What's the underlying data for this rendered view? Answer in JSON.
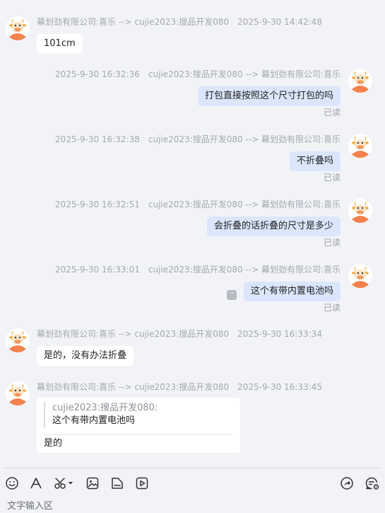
{
  "messages": [
    {
      "meta_name": "幕划劲有限公司:喜乐 --> cujie2023:搜品开发080",
      "time": "2025-9-30 14:42:48",
      "text": "101cm"
    },
    {
      "meta_name": "cujie2023:搜品开发080 --> 幕划劲有限公司:喜乐",
      "time": "2025-9-30 16:32:36",
      "text": "打包直接按照这个尺寸打包的吗",
      "status": "已读"
    },
    {
      "meta_name": "cujie2023:搜品开发080 --> 幕划劲有限公司:喜乐",
      "time": "2025-9-30 16:32:38",
      "text": "不折叠吗",
      "status": "已读"
    },
    {
      "meta_name": "cujie2023:搜品开发080 --> 幕划劲有限公司:喜乐",
      "time": "2025-9-30 16:32:51",
      "text": "会折叠的话折叠的尺寸是多少",
      "status": "已读"
    },
    {
      "meta_name": "cujie2023:搜品开发080 --> 幕划劲有限公司:喜乐",
      "time": "2025-9-30 16:33:01",
      "text": "这个有带内置电池吗",
      "status": "已读",
      "more_glyph": "···"
    },
    {
      "meta_name": "幕划劲有限公司:喜乐 --> cujie2023:搜品开发080",
      "time": "2025-9-30 16:33:34",
      "text": "是的，没有办法折叠"
    },
    {
      "meta_name": "幕划劲有限公司:喜乐 --> cujie2023:搜品开发080",
      "time": "2025-9-30 16:33:45",
      "quote_sender": "cujie2023:搜品开发080:",
      "quote_text": "这个有带内置电池吗",
      "text": "是的"
    }
  ],
  "composer": {
    "placeholder": "文字输入区",
    "tools_left": [
      "emoji-icon",
      "font-icon",
      "scissors-icon",
      "image-icon",
      "file-icon",
      "video-icon"
    ],
    "tools_right": [
      "share-icon",
      "chat-settings-icon"
    ]
  },
  "colors": {
    "background": "#f2f3f7",
    "incoming_bubble": "#ffffff",
    "outgoing_bubble": "#dbe6fd",
    "meta_text": "#a5a8b0",
    "avatar_orange": "#f5824e"
  }
}
